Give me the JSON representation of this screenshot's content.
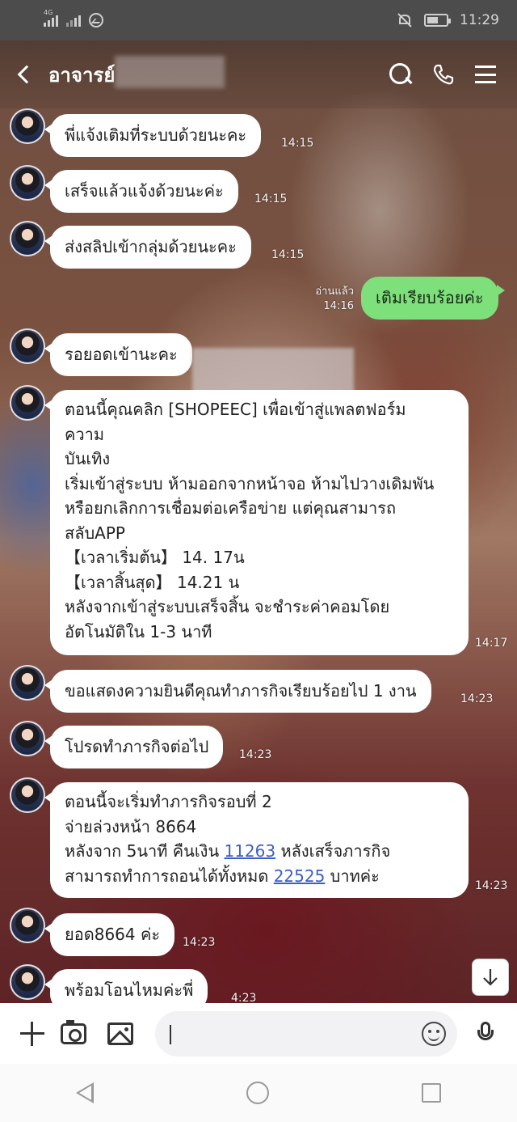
{
  "status_bar": {
    "network": "4G",
    "time": "11:29"
  },
  "header": {
    "contact_name": "อาจารย์"
  },
  "messages": [
    {
      "side": "in",
      "lines": [
        "พี่แจ้งเติมที่ระบบด้วยนะคะ"
      ],
      "time": "14:15"
    },
    {
      "side": "in",
      "lines": [
        "เสร็จแล้วแจ้งด้วยนะค่ะ"
      ],
      "time": "14:15"
    },
    {
      "side": "in",
      "lines": [
        "ส่งสลิปเข้ากลุ่มด้วยนะคะ"
      ],
      "time": "14:15"
    },
    {
      "side": "out",
      "lines": [
        "เติมเรียบร้อยค่ะ"
      ],
      "read_label": "อ่านแล้ว",
      "time": "14:16"
    },
    {
      "side": "in",
      "lines": [
        "รอยอดเข้านะคะ"
      ],
      "time": ""
    },
    {
      "side": "in",
      "lines": [
        "ตอนนี้คุณคลิก [SHOPEEC] เพื่อเข้าสู่แพลตฟอร์ม",
        "ความ",
        "บันเทิง",
        "เริ่มเข้าสู่ระบบ ห้ามออกจากหน้าจอ ห้ามไปวางเดิมพัน",
        "หรือยกเลิกการเชื่อมต่อเครือข่าย  แต่คุณสามารถ",
        "สลับAPP",
        "【เวลาเริ่มต้น】 14. 17น",
        "【เวลาสิ้นสุด】 14.21 น",
        "หลังจากเข้าสู่ระบบเสร็จสิ้น จะชำระค่าคอมโดย",
        "อัตโนมัติใน 1-3 นาที"
      ],
      "time": "14:17"
    },
    {
      "side": "in",
      "lines": [
        "ขอแสดงความยินดีคุณทำภารกิจเรียบร้อยไป 1 งาน"
      ],
      "time": "14:23"
    },
    {
      "side": "in",
      "lines": [
        "โปรดทำภารกิจต่อไป"
      ],
      "time": "14:23"
    },
    {
      "side": "in",
      "lines_rich": {
        "l1": "ตอนนี้จะเริ่มทำภารกิจรอบที่ 2",
        "l2": "จ่ายล่วงหน้า 8664",
        "l3_pre": "หลังจาก 5นาที คืนเงิน  ",
        "l3_link": "11263",
        "l3_post": " หลังเสร็จภารกิจ",
        "l4_pre": "สามารถทำการถอนได้ทั้งหมด ",
        "l4_link": "22525",
        "l4_post": " บาทค่ะ"
      },
      "time": "14:23"
    },
    {
      "side": "in",
      "lines": [
        "ยอด8664 ค่ะ"
      ],
      "time": "14:23"
    },
    {
      "side": "in",
      "lines": [
        "พร้อมโอนไหมค่ะพี่"
      ],
      "time": "4:23"
    }
  ],
  "input": {
    "placeholder": ""
  },
  "icons": {
    "back": "chevron-left-icon",
    "search": "search-icon",
    "call": "phone-icon",
    "menu": "hamburger-menu-icon",
    "add": "plus-icon",
    "camera": "camera-icon",
    "gallery": "image-icon",
    "emoji": "emoji-icon",
    "mic": "microphone-icon",
    "scroll_down": "arrow-down-icon"
  },
  "colors": {
    "outgoing_bubble": "#7ee07a",
    "incoming_bubble": "#ffffff",
    "link": "#3b5fc4"
  }
}
